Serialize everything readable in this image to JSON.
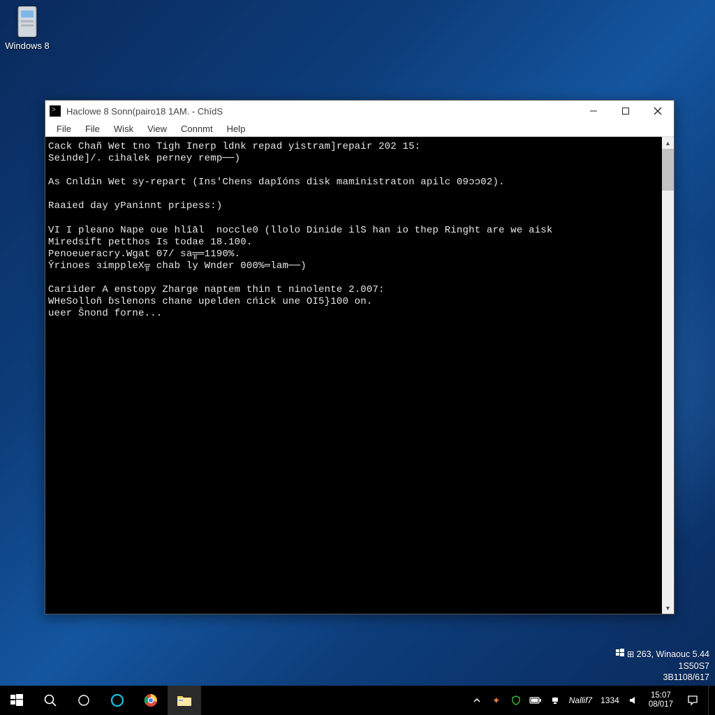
{
  "desktop": {
    "icon_label": "Windows 8",
    "icon_name": "drive-icon"
  },
  "window": {
    "title": "Haclowe 8 Sonn(pairo18 1AM. - ChīdS",
    "menu": [
      "File",
      "File",
      "Wisk",
      "View",
      "Connmt",
      "Help"
    ],
    "terminal_lines": [
      "Cack Chañ Wet tno Tigh Inerp ldnk repad yistram]repair 202 15:",
      "Seinde]/. cihalek perney remp──)",
      "",
      "As Cnldin Wet sy-repart (Ins'Chens dapĩóns disk maministraton apilc 09ɔɔ02).",
      "",
      "Raaied day yPaninnt pripess:)",
      "",
      "VI I pleano Nape oue hlîāl  noccle0 (llolo Dinide ilS han io thep Ringht are we aisk",
      "Miredsift petthos Is todae 18.100.",
      "Penoeueracry.Wgat 07/ sa╦═1190%.",
      "Ȳrinoes ɜimppleX╦ chab ly Wnder 000%═lam──)",
      "",
      "Cariider A enstopy Zharge naptem thin t ninolente 2.007:",
      "WHeSolloñ ɓslenons chane upelden cńick une OI5}100 on.",
      "ueer Ŝnond forne..."
    ]
  },
  "watermark": {
    "line1_prefix": "⊞ 263, Winaouc 5.44",
    "line2": "1S50S7",
    "line3": "3B1108/617"
  },
  "taskbar": {
    "tray": {
      "net_text": "Nallif7",
      "time_inline": "1334"
    },
    "clock": {
      "time": "15:07",
      "date": "08/017"
    }
  }
}
